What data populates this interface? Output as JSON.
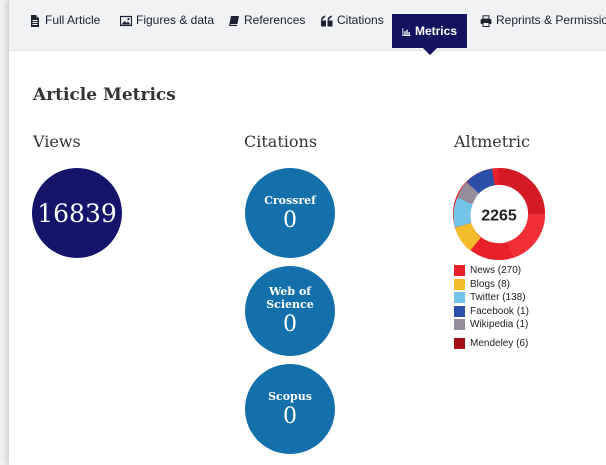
{
  "tabs": [
    {
      "label": "Full Article",
      "icon": "document-icon"
    },
    {
      "label": "Figures & data",
      "icon": "image-icon"
    },
    {
      "label": "References",
      "icon": "book-icon"
    },
    {
      "label": "Citations",
      "icon": "quote-icon"
    },
    {
      "label": "Metrics",
      "icon": "bar-chart-icon",
      "active": true
    },
    {
      "label": "Reprints & Permissions",
      "icon": "print-icon"
    }
  ],
  "page": {
    "heading": "Article Metrics"
  },
  "views": {
    "heading": "Views",
    "count": "16839"
  },
  "citations": {
    "heading": "Citations",
    "items": [
      {
        "name": "Crossref",
        "count": "0"
      },
      {
        "name": "Web of Science",
        "count": "0"
      },
      {
        "name": "Scopus",
        "count": "0"
      }
    ]
  },
  "altmetric": {
    "heading": "Altmetric",
    "score": "2265",
    "sources": [
      {
        "label": "News (270)",
        "color": "#e8202a"
      },
      {
        "label": "Blogs (8)",
        "color": "#f4bc2a"
      },
      {
        "label": "Twitter (138)",
        "color": "#72c4e8"
      },
      {
        "label": "Facebook (1)",
        "color": "#2b4fa8"
      },
      {
        "label": "Wikipedia (1)",
        "color": "#938d9c"
      }
    ],
    "readers": [
      {
        "label": "Mendeley (6)",
        "color": "#a40f16"
      }
    ]
  },
  "colors": {
    "active_tab": "#13135f",
    "views_circle": "#14146b",
    "citation_circle": "#1470aa"
  }
}
